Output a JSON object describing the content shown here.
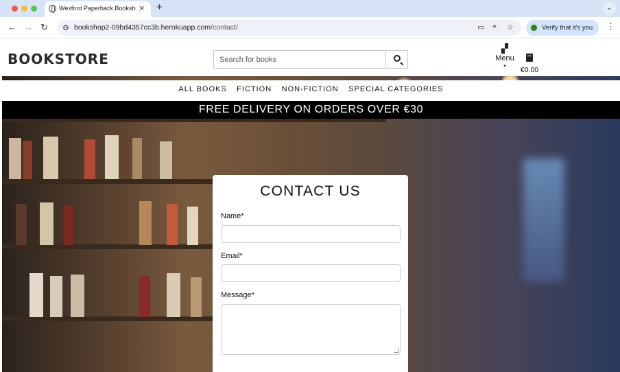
{
  "browser": {
    "tab_title": "Wexford Paperback Bookshop",
    "tab_close": "×",
    "new_tab": "+",
    "tab_list": "⌄",
    "back": "←",
    "forward": "→",
    "reload": "↻",
    "url_host": "bookshop2-09bd4357cc3b.herokuapp.com",
    "url_path": "/contact/",
    "verify_label": "Verify that it's you",
    "menu": "⋮"
  },
  "header": {
    "logo": "BOOKSTORE",
    "search_placeholder": "Search for books",
    "menu_label": "Menu",
    "menu_caret": "▾",
    "bag_total": "€0.00"
  },
  "nav": {
    "items": [
      "ALL BOOKS",
      "FICTION",
      "NON-FICTION",
      "SPECIAL CATEGORIES"
    ]
  },
  "banner": {
    "text": "FREE DELIVERY ON ORDERS OVER €30"
  },
  "contact": {
    "title": "CONTACT US",
    "name_label": "Name*",
    "email_label": "Email*",
    "message_label": "Message*"
  },
  "colors": {
    "banner_bg": "#000000",
    "tab_strip": "#d7e3f7"
  }
}
